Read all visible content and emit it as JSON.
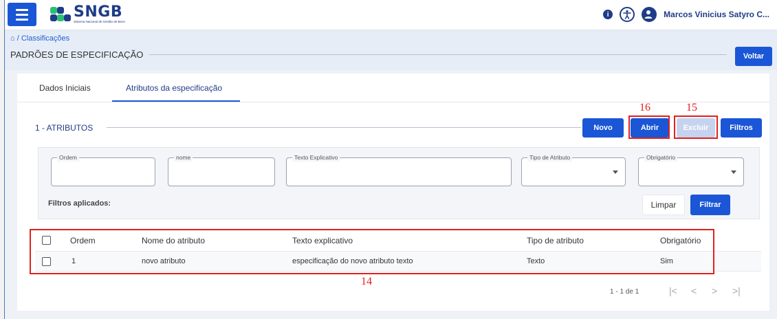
{
  "header": {
    "app_name": "SNGB",
    "app_subtitle": "Sistema Nacional de Gestão de Bens",
    "user_name": "Marcos Vinicius Satyro C..."
  },
  "colors": {
    "primary": "#1a56d6",
    "navy": "#1f3c88",
    "annotation": "#e02020",
    "disabled": "#c5d3ee"
  },
  "icons": [
    "menu-icon",
    "info-icon",
    "accessibility-icon",
    "user-check-icon",
    "home-icon",
    "chevron-down-icon",
    "first-page-icon",
    "prev-page-icon",
    "next-page-icon",
    "last-page-icon"
  ],
  "breadcrumb": {
    "path": "/ Classificações"
  },
  "page": {
    "title": "PADRÕES DE ESPECIFICAÇÃO",
    "back_label": "Voltar"
  },
  "tabs": [
    {
      "label": "Dados Iniciais",
      "active": false
    },
    {
      "label": "Atributos da especificação",
      "active": true
    }
  ],
  "section": {
    "title": "1 - ATRIBUTOS",
    "buttons": {
      "novo": "Novo",
      "abrir": "Abrir",
      "excluir": "Excluir",
      "filtros": "Filtros"
    }
  },
  "filters": {
    "fields": [
      {
        "label": "Ordem",
        "value": ""
      },
      {
        "label": "nome",
        "value": ""
      },
      {
        "label": "Texto Explicativo",
        "value": ""
      },
      {
        "label": "Tipo de Atributo",
        "value": ""
      },
      {
        "label": "Obrigatório",
        "value": ""
      }
    ],
    "applied_label": "Filtros aplicados:",
    "clear_label": "Limpar",
    "apply_label": "Filtrar"
  },
  "table": {
    "columns": [
      "Ordem",
      "Nome do atributo",
      "Texto explicativo",
      "Tipo de atributo",
      "Obrigatório"
    ],
    "rows": [
      {
        "ordem": "1",
        "nome": "novo atributo",
        "texto": "especificação do novo atributo texto",
        "tipo": "Texto",
        "obrigatorio": "Sim"
      }
    ]
  },
  "pagination": {
    "summary": "1 - 1 de 1"
  },
  "annotations": {
    "a14": "14",
    "a15": "15",
    "a16": "16"
  }
}
